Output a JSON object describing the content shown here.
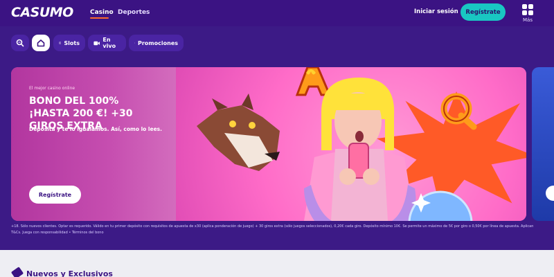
{
  "header": {
    "logo": "CASUMO",
    "nav": [
      {
        "label": "Casino",
        "active": true
      },
      {
        "label": "Deportes",
        "active": false
      }
    ],
    "login_label": "Iniciar sesión",
    "register_label": "Regístrate",
    "more_label": "Más"
  },
  "categories": [
    {
      "label": "",
      "icon": "search-icon"
    },
    {
      "label": "",
      "icon": "home-icon",
      "active": true
    },
    {
      "label": "Slots",
      "icon": "slots-icon"
    },
    {
      "label": "En vivo",
      "icon": "video-camera-icon"
    },
    {
      "label": "Promociones",
      "icon": "gift-icon"
    }
  ],
  "hero": {
    "eyebrow": "El mejor casino online",
    "title": "BONO DEL 100% ¡HASTA 200 €! +30 GIROS EXTRA",
    "subtitle": "Deposita y te lo igualamos. Así, como lo lees.",
    "cta": "Regístrate"
  },
  "terms": "+18. Sólo nuevos clientes. Optar es requerido. Válido en tu primer depósito con requisitos de apuesta de x30 (aplica ponderación de juego) + 30 giros extra (sólo juegos seleccionados), 0,20€ cada giro. Depósito mínimo 10€. Se permite un máximo de 5€ por giro o 0,50€ por línea de apuesta. Aplican T&Cs. Juega con responsabilidad • Términos del bono",
  "section": {
    "title": "Nuevos y Exclusivos",
    "icon": "tag-icon"
  },
  "colors": {
    "header_bg": "#3b1383",
    "page_bg": "#3c1a86",
    "accent_teal": "#19c6c2",
    "hero_pink": "#ff5cc4",
    "burst_orange": "#ff5a27"
  }
}
